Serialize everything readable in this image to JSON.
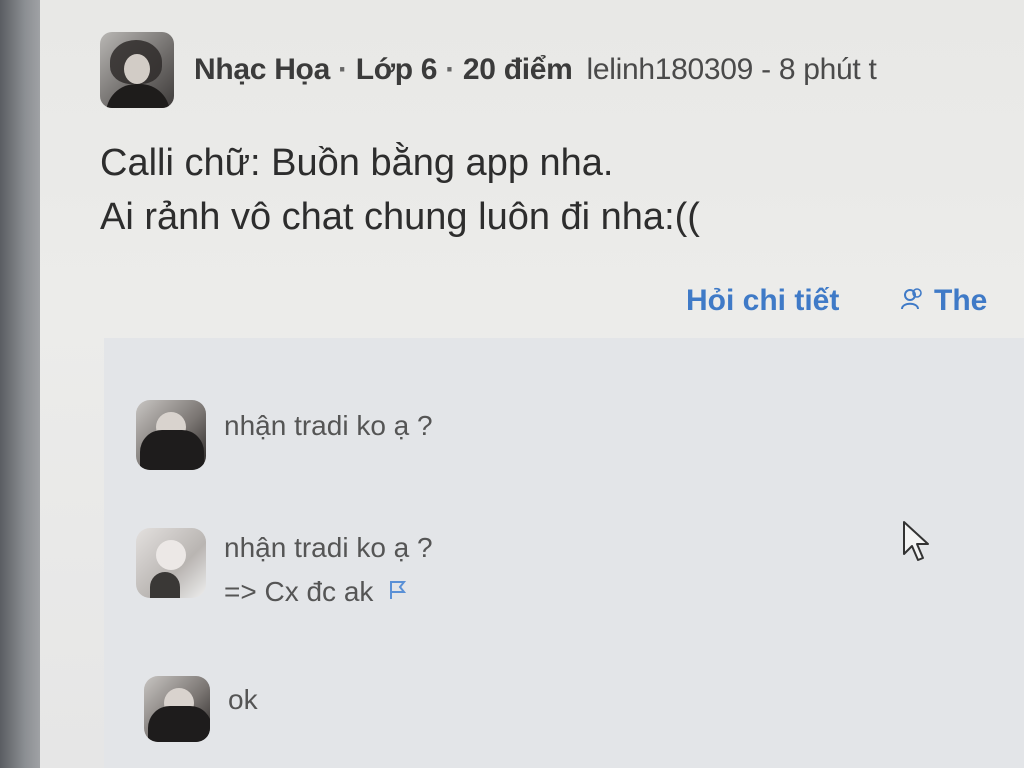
{
  "post": {
    "subject": "Nhạc Họa",
    "grade": "Lớp 6",
    "points": "20 điểm",
    "author_time": "lelinh180309 - 8 phút t",
    "line1": "Calli chữ: Buồn bằng app nha.",
    "line2": "Ai rảnh vô chat chung luôn đi nha:(("
  },
  "actions": {
    "ask_detail": "Hỏi chi tiết",
    "follow": "The"
  },
  "comments": [
    {
      "text": "nhận tradi ko ạ ?"
    },
    {
      "quote": "nhận tradi ko ạ ?",
      "reply": "=> Cx đc ak"
    },
    {
      "text": "ok"
    }
  ],
  "icons": {
    "flag": "flag-icon",
    "follow": "users-icon",
    "cursor": "mouse-pointer-icon"
  },
  "colors": {
    "link": "#3f7ac7",
    "flag": "#5a90d6"
  }
}
